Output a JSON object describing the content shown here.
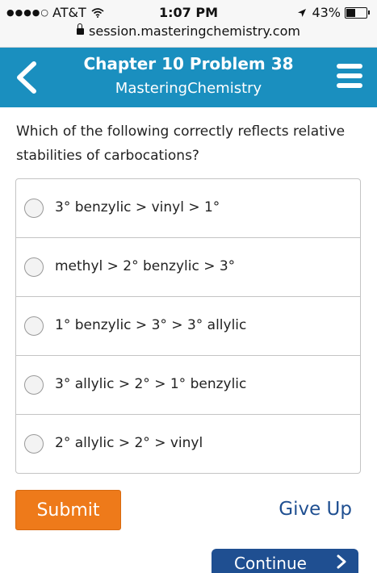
{
  "status_bar": {
    "carrier": "AT&T",
    "time": "1:07 PM",
    "battery": "43%",
    "battery_level": 0.43,
    "url": "session.masteringchemistry.com"
  },
  "header": {
    "title": "Chapter 10 Problem 38",
    "subtitle": "MasteringChemistry"
  },
  "question": {
    "text": "Which of the following correctly reflects relative stabilities of carbocations?"
  },
  "options": [
    {
      "label": "3° benzylic > vinyl > 1°"
    },
    {
      "label": "methyl > 2° benzylic > 3°"
    },
    {
      "label": "1° benzylic > 3° > 3° allylic"
    },
    {
      "label": "3° allylic > 2° > 1° benzylic"
    },
    {
      "label": "2° allylic > 2° > vinyl"
    }
  ],
  "actions": {
    "submit_label": "Submit",
    "give_up_label": "Give Up",
    "continue_label": "Continue"
  },
  "colors": {
    "header_bg": "#1a8fbf",
    "submit_bg": "#ee7a1a",
    "link": "#1f4f91"
  }
}
